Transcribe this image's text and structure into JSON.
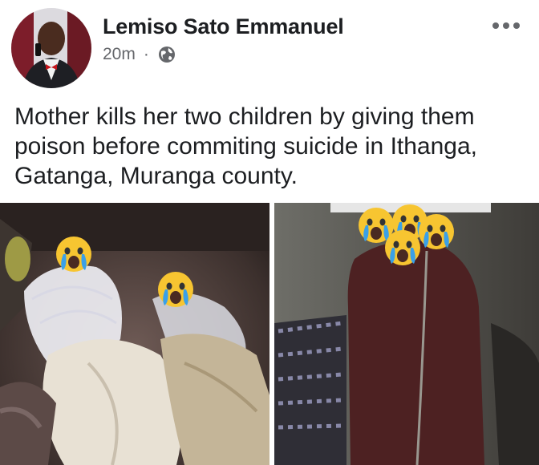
{
  "post": {
    "author": "Lemiso Sato Emmanuel",
    "time": "20m",
    "separator": "·",
    "audience_icon": "globe-icon",
    "more_icon": "more-options-icon",
    "text": "Mother kills her two children by giving them poison before commiting suicide in Ithanga, Gatanga, Muranga county."
  },
  "photos": [
    {
      "label": "photo-1",
      "overlay_icon": "crying-face-emoji"
    },
    {
      "label": "photo-2",
      "overlay_icon": "crying-face-emoji"
    }
  ],
  "colors": {
    "text_primary": "#1c1e21",
    "text_secondary": "#65676b",
    "background": "#ffffff",
    "emoji_yellow": "#f7c531",
    "emoji_tears": "#3aa0e8"
  }
}
